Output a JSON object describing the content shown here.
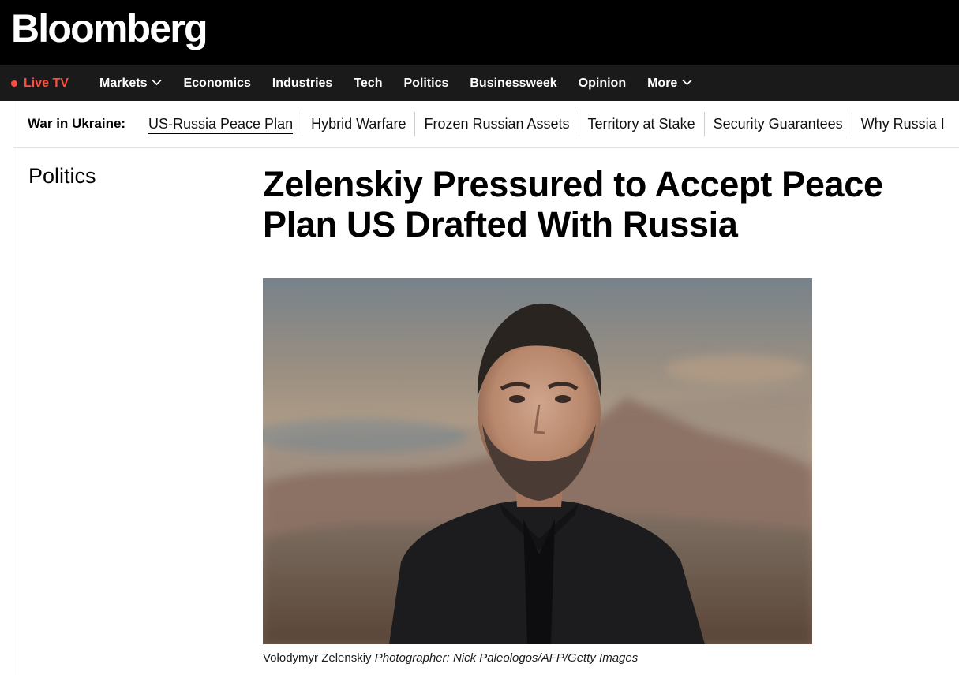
{
  "brand": {
    "logo_text": "Bloomberg"
  },
  "nav": {
    "live_label": "Live TV",
    "live_color": "#ff4d3f",
    "items": [
      {
        "label": "Markets",
        "has_dropdown": true
      },
      {
        "label": "Economics",
        "has_dropdown": false
      },
      {
        "label": "Industries",
        "has_dropdown": false
      },
      {
        "label": "Tech",
        "has_dropdown": false
      },
      {
        "label": "Politics",
        "has_dropdown": false
      },
      {
        "label": "Businessweek",
        "has_dropdown": false
      },
      {
        "label": "Opinion",
        "has_dropdown": false
      },
      {
        "label": "More",
        "has_dropdown": true
      }
    ]
  },
  "topics": {
    "lead": "War in Ukraine:",
    "items": [
      {
        "label": "US-Russia Peace Plan",
        "active": true
      },
      {
        "label": "Hybrid Warfare",
        "active": false
      },
      {
        "label": "Frozen Russian Assets",
        "active": false
      },
      {
        "label": "Territory at Stake",
        "active": false
      },
      {
        "label": "Security Guarantees",
        "active": false
      },
      {
        "label": "Why Russia I",
        "active": false
      }
    ]
  },
  "article": {
    "section": "Politics",
    "headline": "Zelenskiy Pressured to Accept Peace Plan US Drafted With Russia",
    "caption_subject": "Volodymyr Zelenskiy",
    "caption_credit": "Photographer: Nick Paleologos/AFP/Getty Images"
  },
  "colors": {
    "brand_bar": "#000000",
    "nav_bar": "#1a1a1a",
    "accent_live": "#ff4d3f"
  }
}
